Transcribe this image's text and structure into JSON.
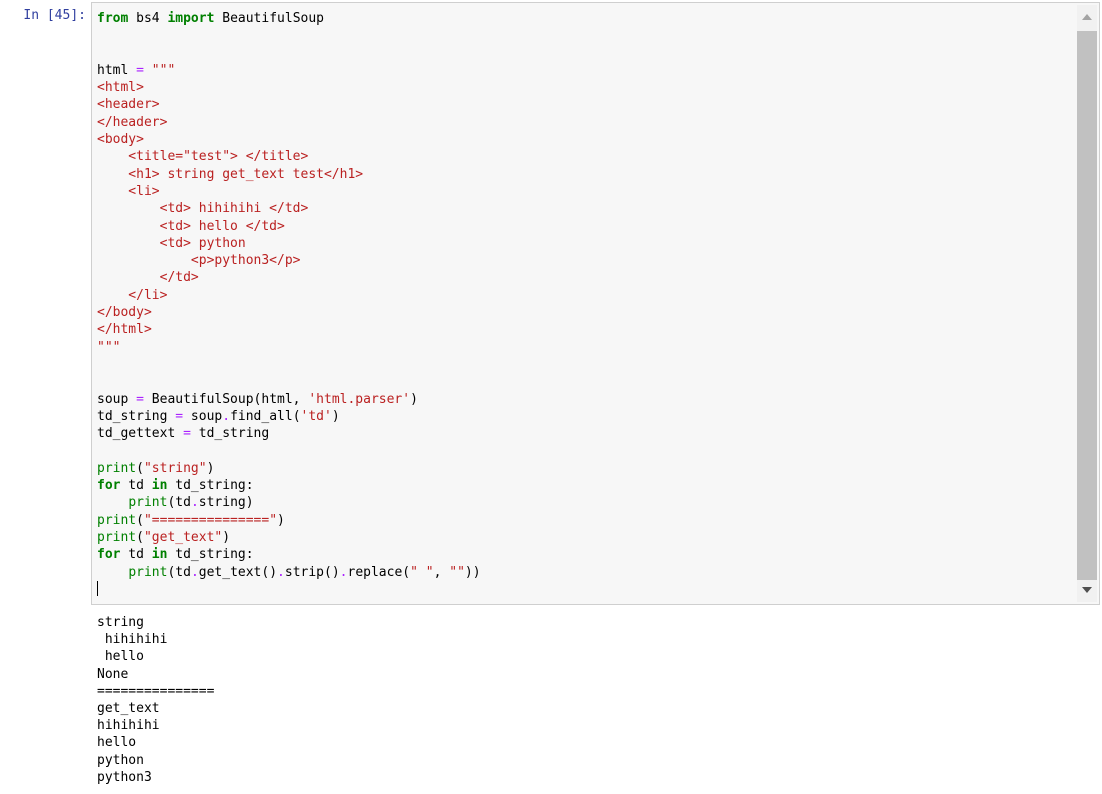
{
  "cell": {
    "prompt": "In [45]:",
    "code_lines": [
      [
        {
          "t": "from",
          "c": "kw"
        },
        {
          "t": " bs4 ",
          "c": "nm"
        },
        {
          "t": "import",
          "c": "kw"
        },
        {
          "t": " BeautifulSoup",
          "c": "nm"
        }
      ],
      [],
      [],
      [
        {
          "t": "html ",
          "c": "nm"
        },
        {
          "t": "=",
          "c": "op"
        },
        {
          "t": " \"\"\"",
          "c": "str"
        }
      ],
      [
        {
          "t": "<html>",
          "c": "str"
        }
      ],
      [
        {
          "t": "<header>",
          "c": "str"
        }
      ],
      [
        {
          "t": "</header>",
          "c": "str"
        }
      ],
      [
        {
          "t": "<body>",
          "c": "str"
        }
      ],
      [
        {
          "t": "    <title=\"test\"> </title>",
          "c": "str"
        }
      ],
      [
        {
          "t": "    <h1> string get_text test</h1>",
          "c": "str"
        }
      ],
      [
        {
          "t": "    <li>",
          "c": "str"
        }
      ],
      [
        {
          "t": "        <td> hihihihi </td>",
          "c": "str"
        }
      ],
      [
        {
          "t": "        <td> hello </td>",
          "c": "str"
        }
      ],
      [
        {
          "t": "        <td> python",
          "c": "str"
        }
      ],
      [
        {
          "t": "            <p>python3</p>",
          "c": "str"
        }
      ],
      [
        {
          "t": "        </td>",
          "c": "str"
        }
      ],
      [
        {
          "t": "    </li>",
          "c": "str"
        }
      ],
      [
        {
          "t": "</body>",
          "c": "str"
        }
      ],
      [
        {
          "t": "</html>",
          "c": "str"
        }
      ],
      [
        {
          "t": "\"\"\"",
          "c": "str"
        }
      ],
      [],
      [],
      [
        {
          "t": "soup ",
          "c": "nm"
        },
        {
          "t": "=",
          "c": "op"
        },
        {
          "t": " BeautifulSoup(html, ",
          "c": "nm"
        },
        {
          "t": "'html.parser'",
          "c": "str"
        },
        {
          "t": ")",
          "c": "nm"
        }
      ],
      [
        {
          "t": "td_string ",
          "c": "nm"
        },
        {
          "t": "=",
          "c": "op"
        },
        {
          "t": " soup",
          "c": "nm"
        },
        {
          "t": ".",
          "c": "op"
        },
        {
          "t": "find_all(",
          "c": "nm"
        },
        {
          "t": "'td'",
          "c": "str"
        },
        {
          "t": ")",
          "c": "nm"
        }
      ],
      [
        {
          "t": "td_gettext ",
          "c": "nm"
        },
        {
          "t": "=",
          "c": "op"
        },
        {
          "t": " td_string",
          "c": "nm"
        }
      ],
      [],
      [
        {
          "t": "print",
          "c": "bi"
        },
        {
          "t": "(",
          "c": "nm"
        },
        {
          "t": "\"string\"",
          "c": "str"
        },
        {
          "t": ")",
          "c": "nm"
        }
      ],
      [
        {
          "t": "for",
          "c": "kw"
        },
        {
          "t": " td ",
          "c": "nm"
        },
        {
          "t": "in",
          "c": "kw"
        },
        {
          "t": " td_string:",
          "c": "nm"
        }
      ],
      [
        {
          "t": "    ",
          "c": "nm"
        },
        {
          "t": "print",
          "c": "bi"
        },
        {
          "t": "(td",
          "c": "nm"
        },
        {
          "t": ".",
          "c": "op"
        },
        {
          "t": "string)",
          "c": "nm"
        }
      ],
      [
        {
          "t": "print",
          "c": "bi"
        },
        {
          "t": "(",
          "c": "nm"
        },
        {
          "t": "\"===============\"",
          "c": "str"
        },
        {
          "t": ")",
          "c": "nm"
        }
      ],
      [
        {
          "t": "print",
          "c": "bi"
        },
        {
          "t": "(",
          "c": "nm"
        },
        {
          "t": "\"get_text\"",
          "c": "str"
        },
        {
          "t": ")",
          "c": "nm"
        }
      ],
      [
        {
          "t": "for",
          "c": "kw"
        },
        {
          "t": " td ",
          "c": "nm"
        },
        {
          "t": "in",
          "c": "kw"
        },
        {
          "t": " td_string:",
          "c": "nm"
        }
      ],
      [
        {
          "t": "    ",
          "c": "nm"
        },
        {
          "t": "print",
          "c": "bi"
        },
        {
          "t": "(td",
          "c": "nm"
        },
        {
          "t": ".",
          "c": "op"
        },
        {
          "t": "get_text()",
          "c": "nm"
        },
        {
          "t": ".",
          "c": "op"
        },
        {
          "t": "strip()",
          "c": "nm"
        },
        {
          "t": ".",
          "c": "op"
        },
        {
          "t": "replace(",
          "c": "nm"
        },
        {
          "t": "\" \"",
          "c": "str"
        },
        {
          "t": ", ",
          "c": "nm"
        },
        {
          "t": "\"\"",
          "c": "str"
        },
        {
          "t": "))",
          "c": "nm"
        }
      ],
      []
    ],
    "output_lines": [
      "string",
      " hihihihi ",
      " hello ",
      "None",
      "===============",
      "get_text",
      "hihihihi",
      "hello",
      "python",
      "python3"
    ]
  },
  "colors": {
    "prompt": "#303f9f",
    "keyword": "#008000",
    "string": "#ba2121",
    "operator": "#aa22ff",
    "editor_bg": "#f7f7f7"
  },
  "icons": {
    "scroll_up": "triangle-up-icon",
    "scroll_down": "triangle-down-icon"
  }
}
